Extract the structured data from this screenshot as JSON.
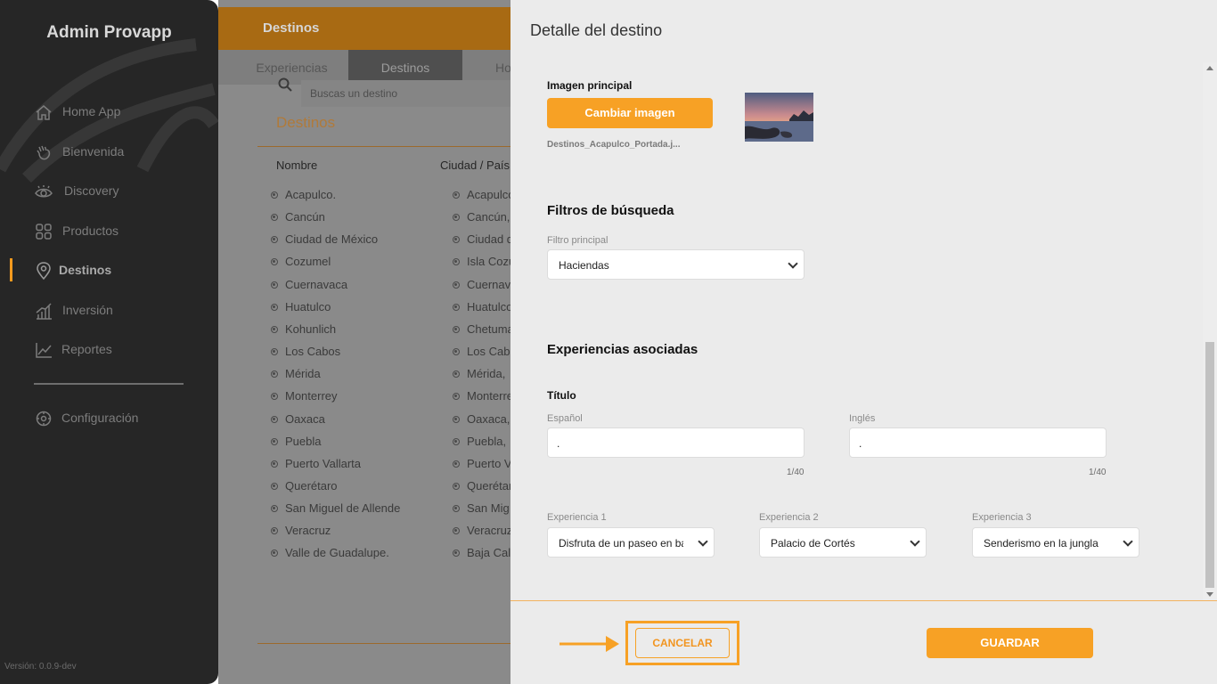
{
  "sidebar": {
    "brand": "Admin Provapp",
    "items": [
      {
        "label": "Home App",
        "icon": "home-icon"
      },
      {
        "label": "Bienvenida",
        "icon": "wave-hand-icon"
      },
      {
        "label": "Discovery",
        "icon": "eye-icon"
      },
      {
        "label": "Productos",
        "icon": "grid-icon"
      },
      {
        "label": "Destinos",
        "icon": "location-pin-icon",
        "active": true
      },
      {
        "label": "Inversión",
        "icon": "bar-chart-icon"
      },
      {
        "label": "Reportes",
        "icon": "line-chart-icon"
      }
    ],
    "settings": {
      "label": "Configuración",
      "icon": "gear-icon"
    },
    "version": "Versión: 0.0.9-dev"
  },
  "main": {
    "header_title": "Destinos",
    "tabs": [
      {
        "label": "Experiencias"
      },
      {
        "label": "Destinos",
        "active": true
      },
      {
        "label": "Ho"
      }
    ],
    "search_placeholder": "Buscas un destino",
    "section_title": "Destinos",
    "columns": [
      "Nombre",
      "Ciudad / País"
    ],
    "rows": [
      {
        "name": "Acapulco.",
        "city": "Acapulco"
      },
      {
        "name": "Cancún",
        "city": "Cancún,"
      },
      {
        "name": "Ciudad de México",
        "city": "Ciudad d"
      },
      {
        "name": "Cozumel",
        "city": "Isla Cozu"
      },
      {
        "name": "Cuernavaca",
        "city": "Cuernav"
      },
      {
        "name": "Huatulco",
        "city": "Huatulco"
      },
      {
        "name": "Kohunlich",
        "city": "Chetuma"
      },
      {
        "name": "Los Cabos",
        "city": "Los Cab"
      },
      {
        "name": "Mérida",
        "city": "Mérida, "
      },
      {
        "name": "Monterrey",
        "city": "Monterre"
      },
      {
        "name": "Oaxaca",
        "city": "Oaxaca,"
      },
      {
        "name": "Puebla",
        "city": "Puebla, "
      },
      {
        "name": "Puerto Vallarta",
        "city": "Puerto V"
      },
      {
        "name": "Querétaro",
        "city": "Querétar"
      },
      {
        "name": "San Miguel de Allende",
        "city": "San Mig"
      },
      {
        "name": "Veracruz",
        "city": "Veracruz"
      },
      {
        "name": "Valle de Guadalupe.",
        "city": "Baja Cal"
      }
    ]
  },
  "modal": {
    "title": "Detalle del destino",
    "image_label": "Imagen principal",
    "change_image_label": "Cambiar imagen",
    "filename": "Destinos_Acapulco_Portada.j...",
    "filters_title": "Filtros de búsqueda",
    "main_filter_label": "Filtro principal",
    "main_filter_value": "Haciendas",
    "experiences_title": "Experiencias asociadas",
    "titulo_label": "Título",
    "spanish_label": "Español",
    "spanish_value": ".",
    "spanish_counter": "1/40",
    "english_label": "Inglés",
    "english_value": ".",
    "english_counter": "1/40",
    "exp1_label": "Experiencia 1",
    "exp1_value": "Disfruta de un paseo en barco",
    "exp2_label": "Experiencia 2",
    "exp2_value": "Palacio de Cortés",
    "exp3_label": "Experiencia 3",
    "exp3_value": "Senderismo en la jungla",
    "cancel_label": "CANCELAR",
    "save_label": "GUARDAR"
  },
  "colors": {
    "accent": "#f7a125",
    "sidebar_bg": "#262626",
    "modal_bg": "#ebebeb"
  }
}
